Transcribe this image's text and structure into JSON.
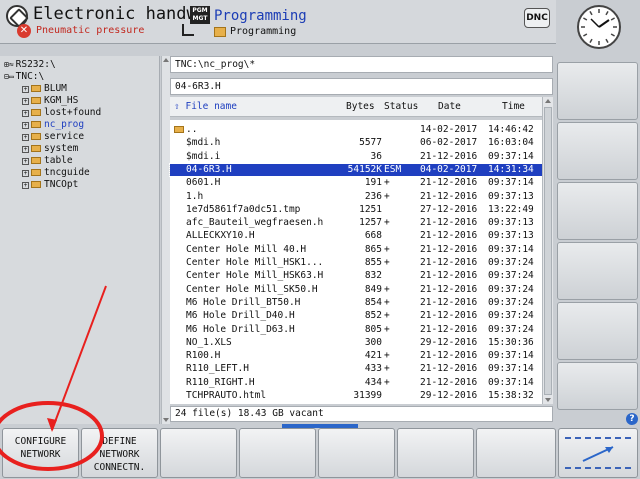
{
  "header": {
    "mode_title": "Electronic handw…",
    "mode_subtitle": "Pneumatic pressure",
    "error_icon": "x-circle-icon",
    "pgm_icon_text": "PGM\nMGT",
    "program_title": "Programming",
    "program_subtitle": "Programming",
    "dnc_label": "DNC"
  },
  "tree": {
    "items": [
      {
        "label": "RS232:\\",
        "icon": "network-icon",
        "indent": 0
      },
      {
        "label": "TNC:\\",
        "icon": "drive-icon",
        "indent": 0
      },
      {
        "label": "BLUM",
        "icon": "folder-icon",
        "indent": 1
      },
      {
        "label": "KGM_HS",
        "icon": "folder-icon",
        "indent": 1
      },
      {
        "label": "lost+found",
        "icon": "folder-icon",
        "indent": 1
      },
      {
        "label": "nc_prog",
        "icon": "folder-icon",
        "indent": 1,
        "selected": true
      },
      {
        "label": "service",
        "icon": "folder-icon",
        "indent": 1
      },
      {
        "label": "system",
        "icon": "folder-icon",
        "indent": 1
      },
      {
        "label": "table",
        "icon": "folder-icon",
        "indent": 1
      },
      {
        "label": "tncguide",
        "icon": "folder-icon",
        "indent": 1
      },
      {
        "label": "TNCOpt",
        "icon": "folder-icon",
        "indent": 1
      }
    ]
  },
  "files": {
    "path": "TNC:\\nc_prog\\*",
    "current_file": "04-6R3.H",
    "columns": {
      "name": "File name",
      "bytes": "Bytes",
      "status": "Status",
      "date": "Date",
      "time": "Time"
    },
    "rows": [
      {
        "name": "..",
        "bytes": "",
        "status": "",
        "date": "14-02-2017",
        "time": "14:46:42",
        "folder": true
      },
      {
        "name": "$mdi.h",
        "bytes": "5577",
        "status": "",
        "date": "06-02-2017",
        "time": "16:03:04"
      },
      {
        "name": "$mdi.i",
        "bytes": "36",
        "status": "",
        "date": "21-12-2016",
        "time": "09:37:14"
      },
      {
        "name": "04-6R3.H",
        "bytes": "54152K",
        "status": "ESM",
        "date": "04-02-2017",
        "time": "14:31:34",
        "selected": true
      },
      {
        "name": "0601.H",
        "bytes": "191",
        "status": "+",
        "date": "21-12-2016",
        "time": "09:37:14"
      },
      {
        "name": "1.h",
        "bytes": "236",
        "status": "+",
        "date": "21-12-2016",
        "time": "09:37:13"
      },
      {
        "name": "1e7d5861f7a0dc51.tmp",
        "bytes": "1251",
        "status": "",
        "date": "27-12-2016",
        "time": "13:22:49"
      },
      {
        "name": "afc_Bauteil_wegfraesen.h",
        "bytes": "1257",
        "status": "+",
        "date": "21-12-2016",
        "time": "09:37:13"
      },
      {
        "name": "ALLECKXY10.H",
        "bytes": "668",
        "status": "",
        "date": "21-12-2016",
        "time": "09:37:13"
      },
      {
        "name": "Center Hole Mill 40.H",
        "bytes": "865",
        "status": "+",
        "date": "21-12-2016",
        "time": "09:37:14"
      },
      {
        "name": "Center Hole Mill_HSK1...",
        "bytes": "855",
        "status": "+",
        "date": "21-12-2016",
        "time": "09:37:24"
      },
      {
        "name": "Center Hole Mill_HSK63.H",
        "bytes": "832",
        "status": "",
        "date": "21-12-2016",
        "time": "09:37:24"
      },
      {
        "name": "Center Hole Mill_SK50.H",
        "bytes": "849",
        "status": "+",
        "date": "21-12-2016",
        "time": "09:37:24"
      },
      {
        "name": "M6 Hole Drill_BT50.H",
        "bytes": "854",
        "status": "+",
        "date": "21-12-2016",
        "time": "09:37:24"
      },
      {
        "name": "M6 Hole Drill_D40.H",
        "bytes": "852",
        "status": "+",
        "date": "21-12-2016",
        "time": "09:37:24"
      },
      {
        "name": "M6 Hole Drill_D63.H",
        "bytes": "805",
        "status": "+",
        "date": "21-12-2016",
        "time": "09:37:24"
      },
      {
        "name": "NO_1.XLS",
        "bytes": "300",
        "status": "",
        "date": "29-12-2016",
        "time": "15:30:36"
      },
      {
        "name": "R100.H",
        "bytes": "421",
        "status": "+",
        "date": "21-12-2016",
        "time": "09:37:14"
      },
      {
        "name": "R110_LEFT.H",
        "bytes": "433",
        "status": "+",
        "date": "21-12-2016",
        "time": "09:37:14"
      },
      {
        "name": "R110_RIGHT.H",
        "bytes": "434",
        "status": "+",
        "date": "21-12-2016",
        "time": "09:37:14"
      },
      {
        "name": "TCHPRAUTO.html",
        "bytes": "31399",
        "status": "",
        "date": "29-12-2016",
        "time": "15:38:32"
      }
    ],
    "status_line": "24  file(s)  18.43 GB vacant"
  },
  "softkeys": {
    "configure_network": "CONFIGURE\nNETWORK",
    "define_network": "DEFINE\nNETWORK\nCONNECTN."
  },
  "icons": {
    "clock": "clock-icon",
    "help": "help-icon",
    "arrow_softkey": "arrow-icon"
  },
  "colors": {
    "accent": "#1f3fc0",
    "selection": "#1f3fc0",
    "error": "#d93a2e",
    "annotation": "#e8201e"
  }
}
